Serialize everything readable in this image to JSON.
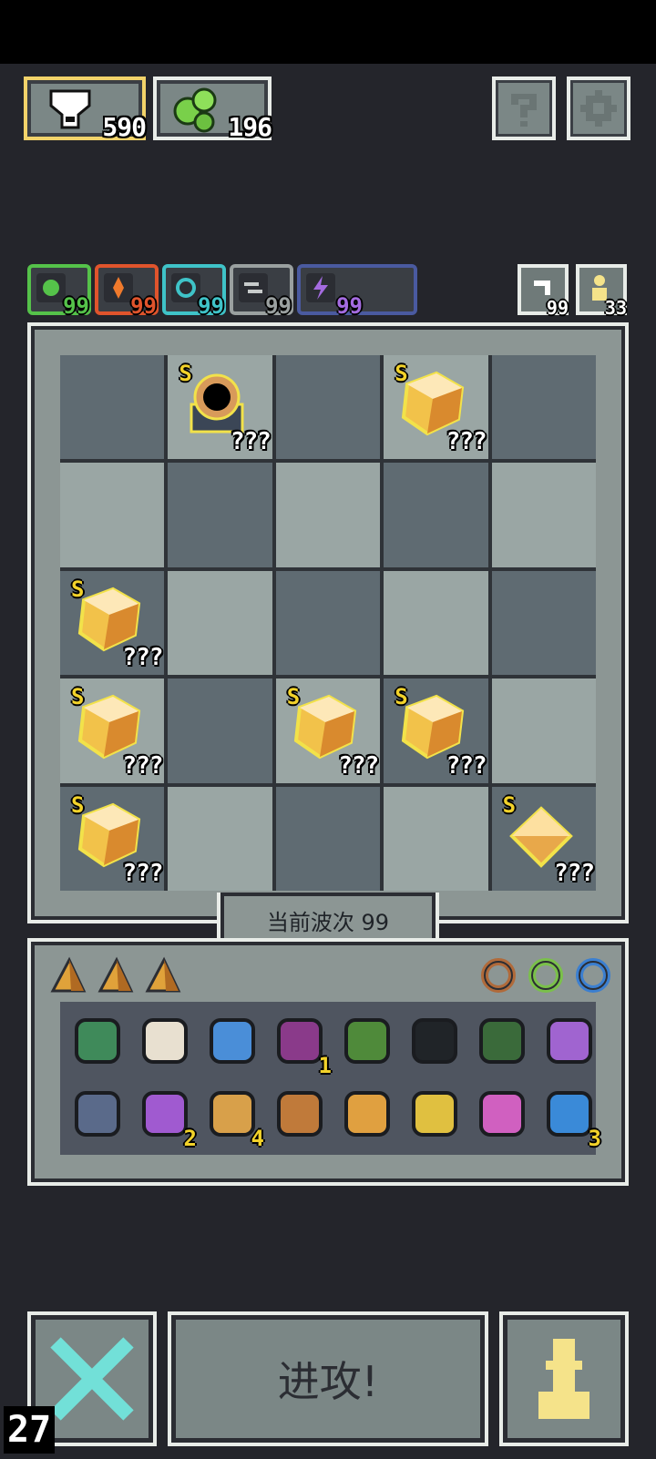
{
  "resources": [
    {
      "name": "bone-resource",
      "value": "590",
      "icon": "skull-bone-icon"
    },
    {
      "name": "slime-resource",
      "value": "196",
      "icon": "green-slime-icon"
    }
  ],
  "top_buttons": {
    "help_icon": "question-icon",
    "settings_icon": "gear-icon"
  },
  "elements": [
    {
      "value": "99",
      "color": "#55c24a",
      "icon": "leaf-icon"
    },
    {
      "value": "99",
      "color": "#e0542c",
      "icon": "fire-icon"
    },
    {
      "value": "99",
      "color": "#3fc3c8",
      "icon": "swirl-icon"
    },
    {
      "value": "99",
      "color": "#9aa0a0",
      "icon": "wind-icon"
    },
    {
      "value": "99",
      "color": "#a46be0",
      "icon": "lightning-icon"
    }
  ],
  "counters": [
    {
      "value": "99",
      "icon": "reroll-icon"
    },
    {
      "value": "33",
      "icon": "pawn-icon"
    }
  ],
  "board": {
    "rows": [
      [
        {
          "tone": "dark"
        },
        {
          "tone": "light",
          "piece": "cannon",
          "rank": "S",
          "level": "???"
        },
        {
          "tone": "dark"
        },
        {
          "tone": "light",
          "piece": "crystal",
          "rank": "S",
          "level": "???"
        },
        {
          "tone": "dark"
        }
      ],
      [
        {
          "tone": "light"
        },
        {
          "tone": "dark"
        },
        {
          "tone": "light"
        },
        {
          "tone": "dark"
        },
        {
          "tone": "light"
        }
      ],
      [
        {
          "tone": "dark",
          "piece": "crystal",
          "rank": "S",
          "level": "???"
        },
        {
          "tone": "light"
        },
        {
          "tone": "dark"
        },
        {
          "tone": "light"
        },
        {
          "tone": "dark"
        }
      ],
      [
        {
          "tone": "light",
          "piece": "crystal",
          "rank": "S",
          "level": "???"
        },
        {
          "tone": "dark"
        },
        {
          "tone": "light",
          "piece": "crystal",
          "rank": "S",
          "level": "???"
        },
        {
          "tone": "dark",
          "piece": "crystal",
          "rank": "S",
          "level": "???"
        },
        {
          "tone": "light"
        }
      ],
      [
        {
          "tone": "dark",
          "piece": "crystal",
          "rank": "S",
          "level": "???"
        },
        {
          "tone": "light"
        },
        {
          "tone": "dark"
        },
        {
          "tone": "light"
        },
        {
          "tone": "dark",
          "piece": "gem",
          "rank": "S",
          "level": "???"
        }
      ]
    ]
  },
  "wave_label": "当前波次 99",
  "inventory": {
    "shards": [
      "shard-icon",
      "shard-icon",
      "shard-icon"
    ],
    "rings": [
      {
        "icon": "bronze-ring-icon",
        "color": "#b06a3a"
      },
      {
        "icon": "green-ring-icon",
        "color": "#7ac04a"
      },
      {
        "icon": "blue-ring-icon",
        "color": "#3b7fd0"
      }
    ],
    "items": [
      {
        "icon": "turtle-shell-icon",
        "count": ""
      },
      {
        "icon": "scroll-icon",
        "count": ""
      },
      {
        "icon": "goggles-icon",
        "count": ""
      },
      {
        "icon": "demon-mask-icon",
        "count": "1"
      },
      {
        "icon": "green-arrow-icon",
        "count": ""
      },
      {
        "icon": "phone-icon",
        "count": ""
      },
      {
        "icon": "rune-tablet-icon",
        "count": ""
      },
      {
        "icon": "purple-hammer-icon",
        "count": ""
      },
      {
        "icon": "crown-spikes-icon",
        "count": ""
      },
      {
        "icon": "potion-jar-icon",
        "count": "2"
      },
      {
        "icon": "orbit-ring-icon",
        "count": "4"
      },
      {
        "icon": "feather-icon",
        "count": ""
      },
      {
        "icon": "claw-icon",
        "count": ""
      },
      {
        "icon": "chalice-icon",
        "count": ""
      },
      {
        "icon": "pink-arrow-icon",
        "count": ""
      },
      {
        "icon": "blue-orb-icon",
        "count": "3"
      }
    ]
  },
  "actions": {
    "attack_label": "进攻!",
    "cancel_icon": "cross-icon",
    "pawn_icon": "pawn-icon"
  },
  "frame_counter": "27"
}
